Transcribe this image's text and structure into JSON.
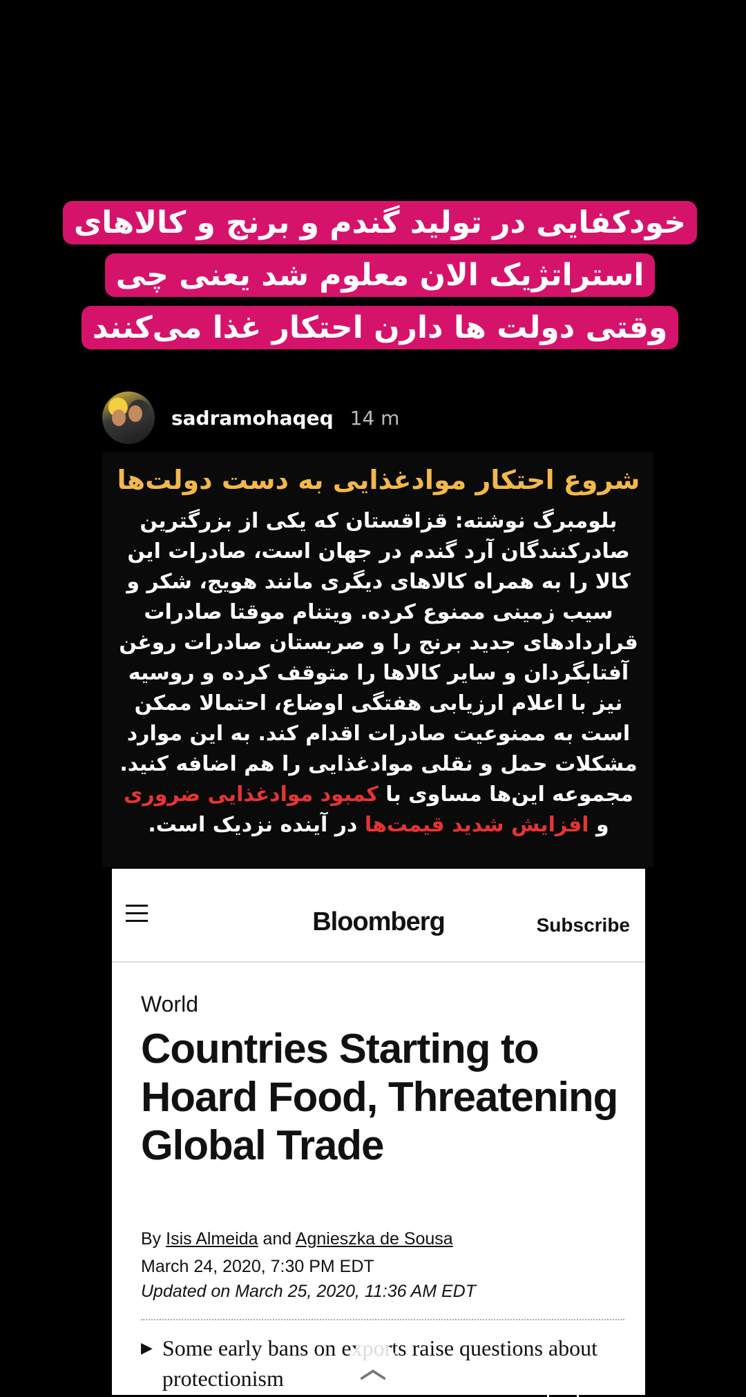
{
  "caption": {
    "lines": [
      "خودکفایی در تولید گندم و برنج و کالاهای",
      "استراتژیک الان معلوم شد یعنی چی",
      "وقتی دولت ها دارن احتکار غذا می‌کنند"
    ]
  },
  "post": {
    "username": "sadramohaqeq",
    "time": "14 m",
    "title": "شروع احتکار موادغذایی به دست دولت‌ها",
    "body_start": "بلومبرگ نوشته: قزاقستان که یکی از بزرگترین صادرکنندگان آرد گندم در جهان است، صادرات این کالا را به همراه کالاهای دیگری مانند هویج، شکر و سیب زمینی ممنوع کرده. ویتنام موقتا صادرات قراردادهای جدید برنج را و صربستان صادرات روغن آفتابگردان و سایر کالاها را متوقف کرده و روسیه نیز با اعلام ارزیابی هفتگی اوضاع، احتمالا ممکن است به ممنوعیت صادرات اقدام کند. به این موارد مشکلات حمل و نقلی موادغذایی را هم اضافه کنید. مجموعه این‌ها مساوی با",
    "highlight_1": "کمبود موادغذایی ضروری",
    "connector": "و",
    "highlight_2": "افزایش شدید قیمت‌ها",
    "body_end": "در آینده نزدیک است."
  },
  "article": {
    "logo": "Bloomberg",
    "subscribe": "Subscribe",
    "section": "World",
    "headline": "Countries Starting to Hoard Food, Threatening Global Trade",
    "by": "By",
    "author1": "Isis Almeida",
    "and": "and",
    "author2": "Agnieszka de Sousa",
    "date": "March 24, 2020, 7:30 PM EDT",
    "updated": "Updated on  March 25, 2020, 11:36 AM EDT",
    "bullet_text": "Some early bans on exports raise questions about protectionism"
  },
  "icons": {
    "menu": "hamburger-icon",
    "bullet": "triangle-right-icon",
    "swipe": "chevron-up-icon"
  },
  "colors": {
    "caption_bg": "#d6136b",
    "post_title": "#f2b84b",
    "highlight": "#e53434"
  }
}
